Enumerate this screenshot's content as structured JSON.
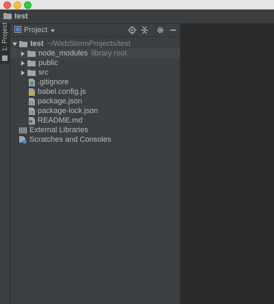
{
  "window": {
    "title": "test"
  },
  "panel": {
    "title": "Project",
    "tree": {
      "root": {
        "name": "test",
        "path": "~/WebStormProjects/test"
      },
      "children": [
        {
          "name": "node_modules",
          "note": "library root"
        },
        {
          "name": "public"
        },
        {
          "name": "src"
        },
        {
          "name": ".gitignore"
        },
        {
          "name": "babel.config.js"
        },
        {
          "name": "package.json"
        },
        {
          "name": "package-lock.json"
        },
        {
          "name": "README.md"
        }
      ],
      "external": {
        "name": "External Libraries"
      },
      "scratches": {
        "name": "Scratches and Consoles"
      }
    }
  },
  "stripe": {
    "label": "1: Project"
  },
  "icons": {
    "folder": "folder-icon",
    "project": "project-view-icon",
    "locate": "locate-target-icon",
    "collapse": "collapse-all-icon",
    "settings": "gear-icon",
    "hide": "minimize-icon"
  },
  "colors": {
    "panel_bg": "#3c3f41",
    "editor_bg": "#2b2b2b",
    "text": "#bbbbbb",
    "muted": "#8a8a8a"
  }
}
